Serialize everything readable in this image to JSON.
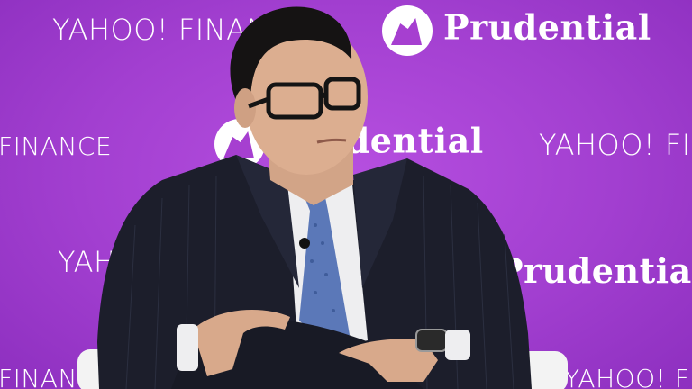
{
  "backdrop": {
    "color": "#a63fd0",
    "logos": {
      "yahoo_finance": "YAHOO! FINANCE",
      "yahoo": "YAHOO!",
      "finance": "FINANCE",
      "prudential": "Prudential"
    }
  },
  "subject": {
    "suit_color": "#1c1e2b",
    "shirt_color": "#eeeef0",
    "tie_color": "#5b78b8",
    "chair_color": "#f2f2f2"
  }
}
